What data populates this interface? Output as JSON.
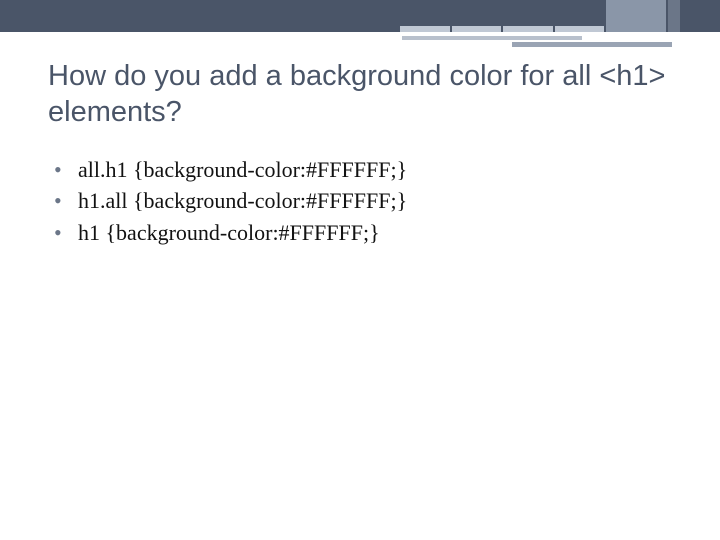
{
  "slide": {
    "title": "How do you add a background color for all <h1> elements?",
    "bullets": [
      "all.h1 {background-color:#FFFFFF;}",
      "h1.all {background-color:#FFFFFF;}",
      "h1 {background-color:#FFFFFF;}"
    ]
  }
}
